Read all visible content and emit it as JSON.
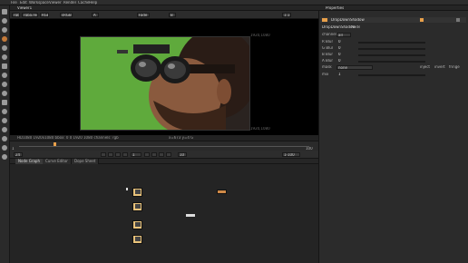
{
  "menubar": {
    "items": [
      "File",
      "Edit",
      "Workspace",
      "Viewer",
      "Render",
      "Cache",
      "Help"
    ]
  },
  "viewer": {
    "tab_label": "Viewer1",
    "toolbar": {
      "channels": "rgba",
      "channel_select": "rgba.red",
      "colorspace": "RGB",
      "compare": "sRGB",
      "mode_a": "A",
      "zoom_in": "Fade",
      "wipe": "B",
      "zoom": "1:1"
    },
    "format_label": "HD_1080",
    "bbox_corner_label": "1920,1080",
    "bbox_corner_bottom": "1920,1080",
    "status": "HD1080 1920x1080  bbox: 0 0 1920 1080 channels: rgb",
    "status_right": "x=673 y=4 G"
  },
  "timeline": {
    "start": "1",
    "end": "100",
    "current": "1",
    "ticks": [
      "1",
      "10",
      "20",
      "30",
      "40",
      "50",
      "60",
      "70",
      "80",
      "90",
      "100"
    ]
  },
  "playbar": {
    "fps": "24",
    "frame": "1",
    "increment": "10",
    "range": "1-100"
  },
  "nodegraph": {
    "tabs": [
      "Node Graph",
      "Curve Editor",
      "Dope Sheet"
    ],
    "active_tab": "Node Graph"
  },
  "properties": {
    "tab_label": "Properties",
    "node_name": "DropDownShadow",
    "sub_tabs": [
      "DropDownShadow",
      "Node"
    ],
    "rows": [
      {
        "label": "channels",
        "value": "all"
      },
      {
        "label": "R Blur",
        "value": "0"
      },
      {
        "label": "G Blur",
        "value": "0"
      },
      {
        "label": "B Blur",
        "value": "0"
      },
      {
        "label": "A Blur",
        "value": "0"
      },
      {
        "label": "mask",
        "value": "none"
      },
      {
        "label": "mix",
        "value": "1"
      }
    ],
    "mask_buttons": [
      "inject",
      "invert",
      "fringe"
    ]
  },
  "colors": {
    "accent": "#e8a04a",
    "green_screen": "#5faa3c",
    "node": "#e8c27a"
  }
}
